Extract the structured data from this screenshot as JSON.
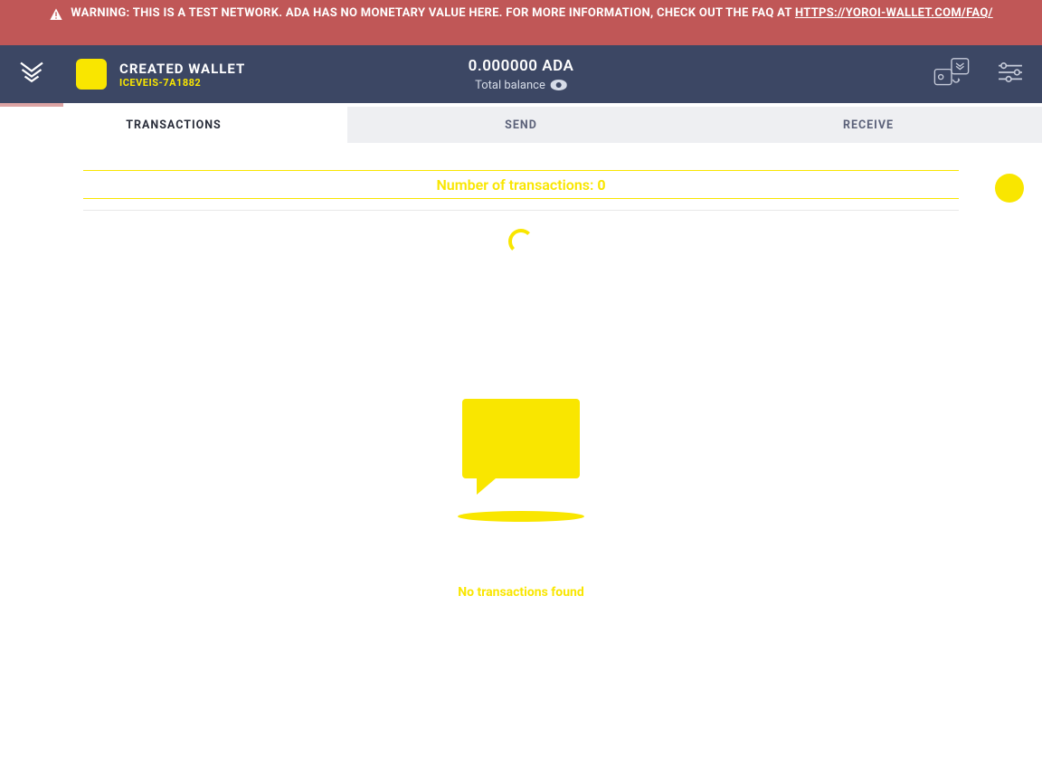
{
  "warning": {
    "text_before_link": "WARNING: THIS IS A TEST NETWORK. ADA HAS NO MONETARY VALUE HERE. FOR MORE INFORMATION, CHECK OUT THE FAQ AT ",
    "link_text": "HTTPS://YOROI-WALLET.COM/FAQ/"
  },
  "wallet": {
    "name": "CREATED WALLET",
    "id_label": "ICEVEIS-7A1882"
  },
  "balance": {
    "amount": "0.000000 ADA",
    "label": "Total balance"
  },
  "tabs": {
    "transactions": "TRANSACTIONS",
    "send": "SEND",
    "receive": "RECEIVE"
  },
  "transactions": {
    "count_label": "Number of transactions: ",
    "count_value": "0",
    "empty_message": "No transactions found"
  },
  "colors": {
    "accent": "#F9E600",
    "header_bg": "#3C4764",
    "warning_bg": "#C05757"
  }
}
